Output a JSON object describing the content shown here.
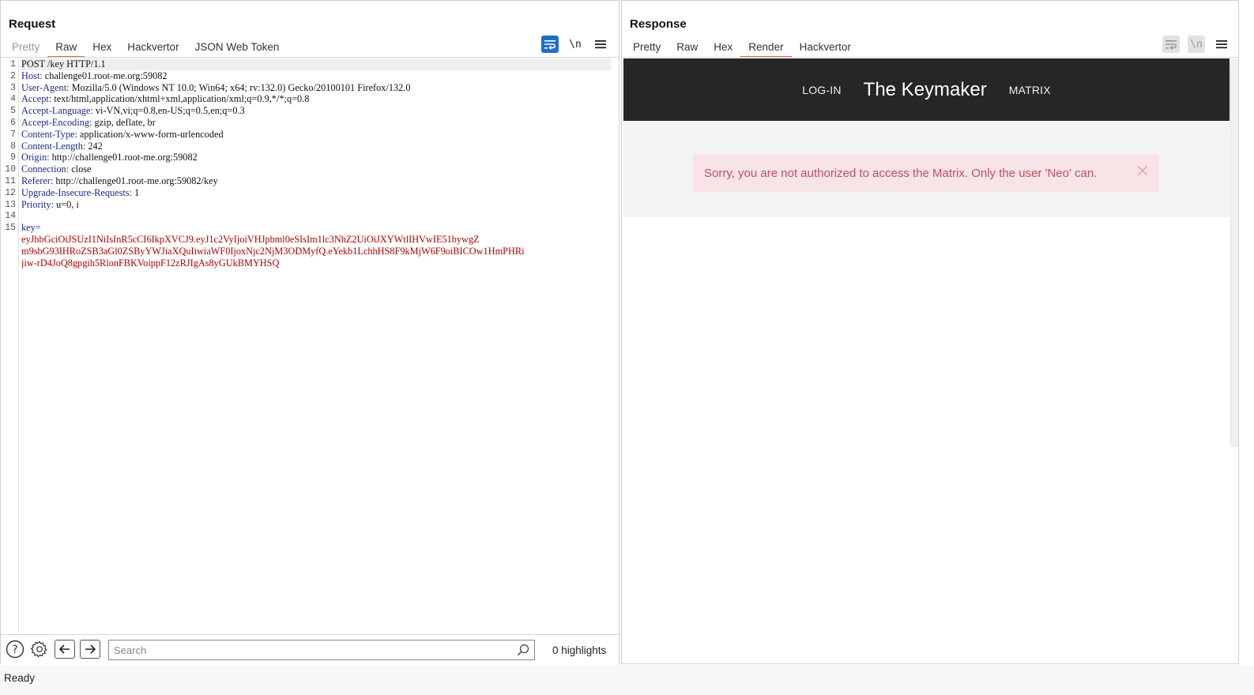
{
  "layout_toggle": {
    "icons": [
      "split-horizontal-icon",
      "split-vertical-icon",
      "single-pane-icon"
    ],
    "active": 0
  },
  "request": {
    "title": "Request",
    "tabs": [
      {
        "label": "Pretty",
        "state": "disabled"
      },
      {
        "label": "Raw",
        "state": "active"
      },
      {
        "label": "Hex",
        "state": "normal"
      },
      {
        "label": "Hackvertor",
        "state": "normal"
      },
      {
        "label": "JSON Web Token",
        "state": "normal"
      }
    ],
    "tools": {
      "wrap_icon": "word-wrap-icon",
      "newline_label": "\\n",
      "menu_icon": "hamburger-menu-icon"
    },
    "lines": [
      {
        "n": "1",
        "plain": "POST /key HTTP/1.1"
      },
      {
        "n": "2",
        "key": "Host:",
        "val": " challenge01.root-me.org:59082"
      },
      {
        "n": "3",
        "key": "User-Agent:",
        "val": " Mozilla/5.0 (Windows NT 10.0; Win64; x64; rv:132.0) Gecko/20100101 Firefox/132.0"
      },
      {
        "n": "4",
        "key": "Accept:",
        "val": " text/html,application/xhtml+xml,application/xml;q=0.9,*/*;q=0.8"
      },
      {
        "n": "5",
        "key": "Accept-Language:",
        "val": " vi-VN,vi;q=0.8,en-US;q=0.5,en;q=0.3"
      },
      {
        "n": "6",
        "key": "Accept-Encoding:",
        "val": " gzip, deflate, br"
      },
      {
        "n": "7",
        "key": "Content-Type:",
        "val": " application/x-www-form-urlencoded"
      },
      {
        "n": "8",
        "key": "Content-Length:",
        "val": " 242"
      },
      {
        "n": "9",
        "key": "Origin:",
        "val": " http://challenge01.root-me.org:59082"
      },
      {
        "n": "10",
        "key": "Connection:",
        "val": " close"
      },
      {
        "n": "11",
        "key": "Referer:",
        "val": " http://challenge01.root-me.org:59082/key"
      },
      {
        "n": "12",
        "key": "Upgrade-Insecure-Requests:",
        "val": " 1"
      },
      {
        "n": "13",
        "key": "Priority:",
        "val": " u=0, i"
      },
      {
        "n": "14",
        "plain": ""
      },
      {
        "n": "15",
        "body_key": "key=",
        "body_lines": [
          "eyJhbGciOiJSUzI1NiIsInR5cCI6IkpXVCJ9.eyJ1c2VyIjoiVHJpbml0eSIsIm1lc3NhZ2UiOiJXYWtlIHVwIE51bywgZ",
          "m9sbG93IHRoZSB3aGl0ZSByYWJiaXQuIiwiaWF0IjoxNjc2NjM3ODMyfQ.eYekb1LchhHS8F9kMjW6F9oiBICOw1HmPHRi",
          "jiw-rD4JoQ8gpgih5RlonFBKVoippF12zRJIgAs8yGUkBMYHSQ"
        ]
      }
    ],
    "bottom": {
      "help_icon": "help-circle-icon",
      "settings_icon": "gear-icon",
      "back_icon": "arrow-left-icon",
      "forward_icon": "arrow-right-icon",
      "search_placeholder": "Search",
      "search_icon": "search-icon",
      "highlights": "0 highlights"
    }
  },
  "response": {
    "title": "Response",
    "tabs": [
      {
        "label": "Pretty",
        "state": "normal"
      },
      {
        "label": "Raw",
        "state": "normal"
      },
      {
        "label": "Hex",
        "state": "normal"
      },
      {
        "label": "Render",
        "state": "active"
      },
      {
        "label": "Hackvertor",
        "state": "normal"
      }
    ],
    "tools": {
      "wrap_icon": "word-wrap-icon",
      "newline_label": "\\n",
      "menu_icon": "hamburger-menu-icon"
    },
    "render": {
      "nav": {
        "login": "LOG-IN",
        "brand": "The Keymaker",
        "matrix": "MATRIX"
      },
      "alert": {
        "text": "Sorry, you are not authorized to access the Matrix. Only the user 'Neo' can.",
        "close_icon": "close-icon"
      }
    }
  },
  "status": {
    "text": "Ready"
  }
}
